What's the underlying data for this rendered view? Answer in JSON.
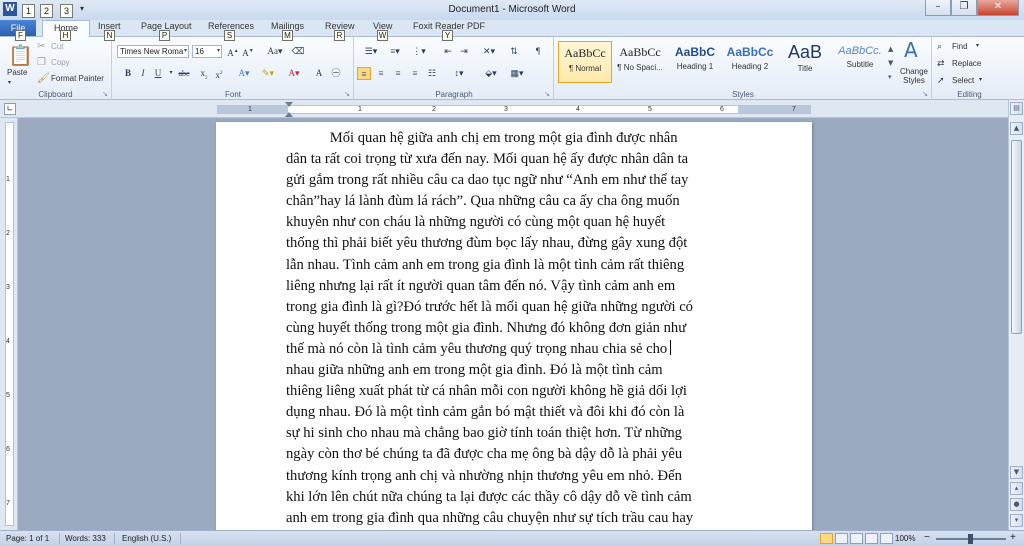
{
  "window": {
    "title": "Document1 - Microsoft Word",
    "app_icon": "W",
    "minimize": "–",
    "restore": "❐",
    "close": "✕"
  },
  "qat": {
    "keytips": [
      "1",
      "2",
      "3"
    ]
  },
  "tabs": {
    "file": "File",
    "home": "Home",
    "insert": "Insert",
    "page_layout": "Page Layout",
    "references": "References",
    "mailings": "Mailings",
    "review": "Review",
    "view": "View",
    "foxit": "Foxit Reader PDF",
    "keytips": {
      "file": "F",
      "home": "H",
      "insert": "N",
      "page_layout": "P",
      "references": "S",
      "mailings": "M",
      "review": "R",
      "view": "W",
      "foxit": "Y"
    }
  },
  "clipboard": {
    "paste": "Paste",
    "cut": "Cut",
    "copy": "Copy",
    "format_painter": "Format Painter",
    "label": "Clipboard"
  },
  "font": {
    "name": "Times New Roma",
    "size": "16",
    "label": "Font"
  },
  "paragraph": {
    "label": "Paragraph"
  },
  "styles": {
    "label": "Styles",
    "change_styles": "Change Styles",
    "items": [
      {
        "sample": "AaBbCc",
        "name": "¶ Normal"
      },
      {
        "sample": "AaBbCc",
        "name": "¶ No Spaci..."
      },
      {
        "sample": "AaBbC",
        "name": "Heading 1"
      },
      {
        "sample": "AaBbCc",
        "name": "Heading 2"
      },
      {
        "sample": "AaB",
        "name": "Title"
      },
      {
        "sample": "AaBbCc.",
        "name": "Subtitle"
      }
    ]
  },
  "editing": {
    "find": "Find",
    "replace": "Replace",
    "select": "Select",
    "label": "Editing"
  },
  "ruler": {
    "numbers": [
      "1",
      "1",
      "2",
      "3",
      "4",
      "5",
      "6",
      "7"
    ],
    "vnumbers": [
      "1",
      "2",
      "3",
      "4",
      "5",
      "6",
      "7"
    ]
  },
  "document": {
    "lines": [
      "            Mối quan hệ giữa anh chị em trong một gia đình được nhân",
      "dân ta rất coi trọng từ xưa đến nay. Mối quan hệ ấy được nhân dân ta",
      "gửi gắm trong rất nhiều câu ca dao tục ngữ như “Anh em như thể tay",
      "chân”hay lá lành đùm lá rách”. Qua những câu ca ấy cha ông muốn",
      "khuyên như con cháu là những người có cùng một quan hệ huyết",
      "thống thì phải biết yêu thương đùm bọc lấy nhau, đừng gây xung đột",
      "lẫn nhau. Tình cảm anh em trong gia đình là một tình cảm rất thiêng",
      "liêng nhưng lại rất ít người quan tâm đến nó. Vậy tình cảm anh em",
      "trong gia đình là gì?Đó trước hết là mối quan hệ giữa những người có",
      "cùng huyết thống trong một gia đình. Nhưng đó không đơn giản như",
      "thế mà nó còn là tình cảm yêu thương quý trọng nhau chia sẻ cho",
      "nhau giữa những anh em trong một gia đình. Đó là một tình cảm",
      "thiêng liêng xuất phát từ cá nhân mỗi con người không hề giả dối lợi",
      "dụng nhau. Đó là một tình cảm gắn bó mật thiết và đôi khi đó còn là",
      "sự hi sinh cho nhau mà chẳng bao giờ tính toán thiệt hơn. Từ những",
      "ngày còn thơ bé chúng ta đã được cha mẹ ông bà dậy dỗ là phải yêu",
      "thương kính trọng anh chị và nhường nhịn thương yêu em nhỏ. Đến",
      "khi lớn lên chút nữa chúng ta lại được các thầy cô dậy dỗ về tình cảm",
      "anh em trong gia đình qua những câu chuyện như sự tích trầu cau hay"
    ]
  },
  "status": {
    "page": "Page: 1 of 1",
    "words": "Words: 333",
    "language": "English (U.S.)",
    "zoom": "100%",
    "zoom_minus": "−",
    "zoom_plus": "+"
  },
  "icons": {
    "cut": "cut-icon",
    "copy": "copy-icon",
    "format_painter": "format-painter-icon",
    "find": "binoculars-icon",
    "help": "help-icon"
  }
}
